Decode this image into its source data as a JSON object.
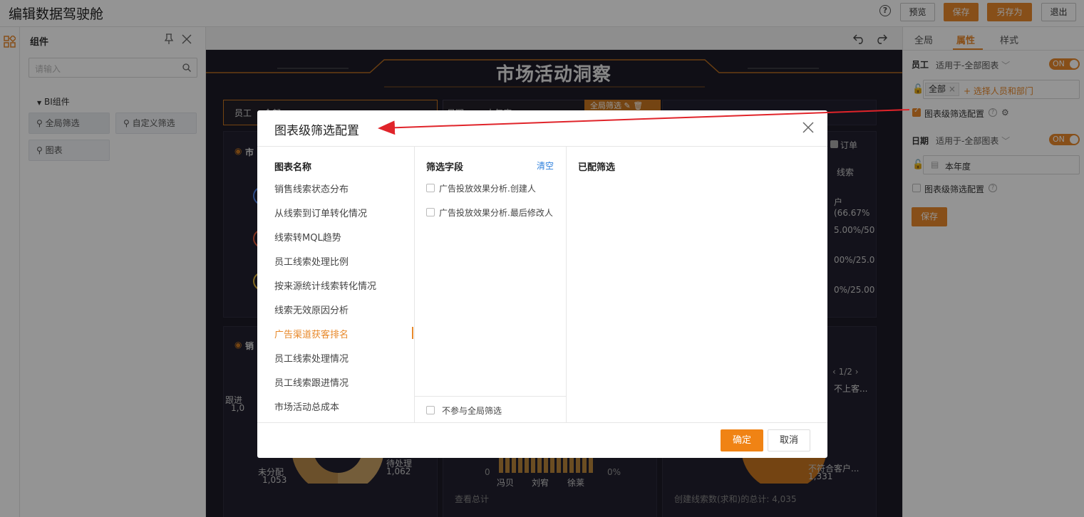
{
  "app": {
    "title": "编辑数据驾驶舱"
  },
  "toolbar": {
    "preview": "预览",
    "save": "保存",
    "save_as": "另存为",
    "exit": "退出"
  },
  "components": {
    "title": "组件",
    "search_placeholder": "请输入",
    "group_label": "BI组件",
    "items": [
      "全局筛选",
      "自定义筛选",
      "图表"
    ]
  },
  "dashboard": {
    "title": "市场活动洞察",
    "filter_staff_label": "员工",
    "filter_staff_value": "全部",
    "filter_date_label": "日期",
    "filter_date_value": "本年度",
    "global_filter_tag": "全局筛选",
    "legend_order": "订单",
    "legend_lead": "线索",
    "pct_1": "户(66.67%",
    "pct_2": "5.00%/50",
    "pct_3": "00%/25.0",
    "pct_4": "0%/25.00",
    "pager": "1/2",
    "no_customer": "不上客...",
    "unassigned_label": "未分配",
    "unassigned_value": "1,053",
    "pending_label": "待处理",
    "pending_value": "1,062",
    "follow_label": "跟进",
    "follow_value": "1,0",
    "bar_zero": "0",
    "bar_zero_pct": "0%",
    "names": [
      "冯贝",
      "刘宥",
      "徐莱"
    ],
    "view_total": "查看总计",
    "nonmatch_label": "不符合客户...",
    "nonmatch_value": "1,331",
    "total_text": "创建线索数(求和)的总计: 4,035"
  },
  "right_panel": {
    "tabs": [
      "全局",
      "属性",
      "样式"
    ],
    "staff_label": "员工",
    "applies_to": "适用于-全部图表",
    "toggle_on": "ON",
    "tag_all": "全部",
    "select_people": "+ 选择人员和部门",
    "chart_filter_config": "图表级筛选配置",
    "date_label": "日期",
    "date_value": "本年度",
    "save": "保存"
  },
  "dialog": {
    "title": "图表级筛选配置",
    "col_chart_name": "图表名称",
    "col_fields": "筛选字段",
    "clear": "清空",
    "col_configured": "已配筛选",
    "charts": [
      "销售线索状态分布",
      "从线索到订单转化情况",
      "线索转MQL趋势",
      "员工线索处理比例",
      "按来源统计线索转化情况",
      "线索无效原因分析",
      "广告渠道获客排名",
      "员工线索处理情况",
      "员工线索跟进情况",
      "市场活动总成本"
    ],
    "active_chart_index": 6,
    "fields": [
      "广告投放效果分析.创建人",
      "广告投放效果分析.最后修改人"
    ],
    "exclude_global": "不参与全局筛选",
    "ok": "确定",
    "cancel": "取消"
  },
  "colors": {
    "accent": "#e8892b",
    "annotation_arrow": "#e0242a"
  }
}
